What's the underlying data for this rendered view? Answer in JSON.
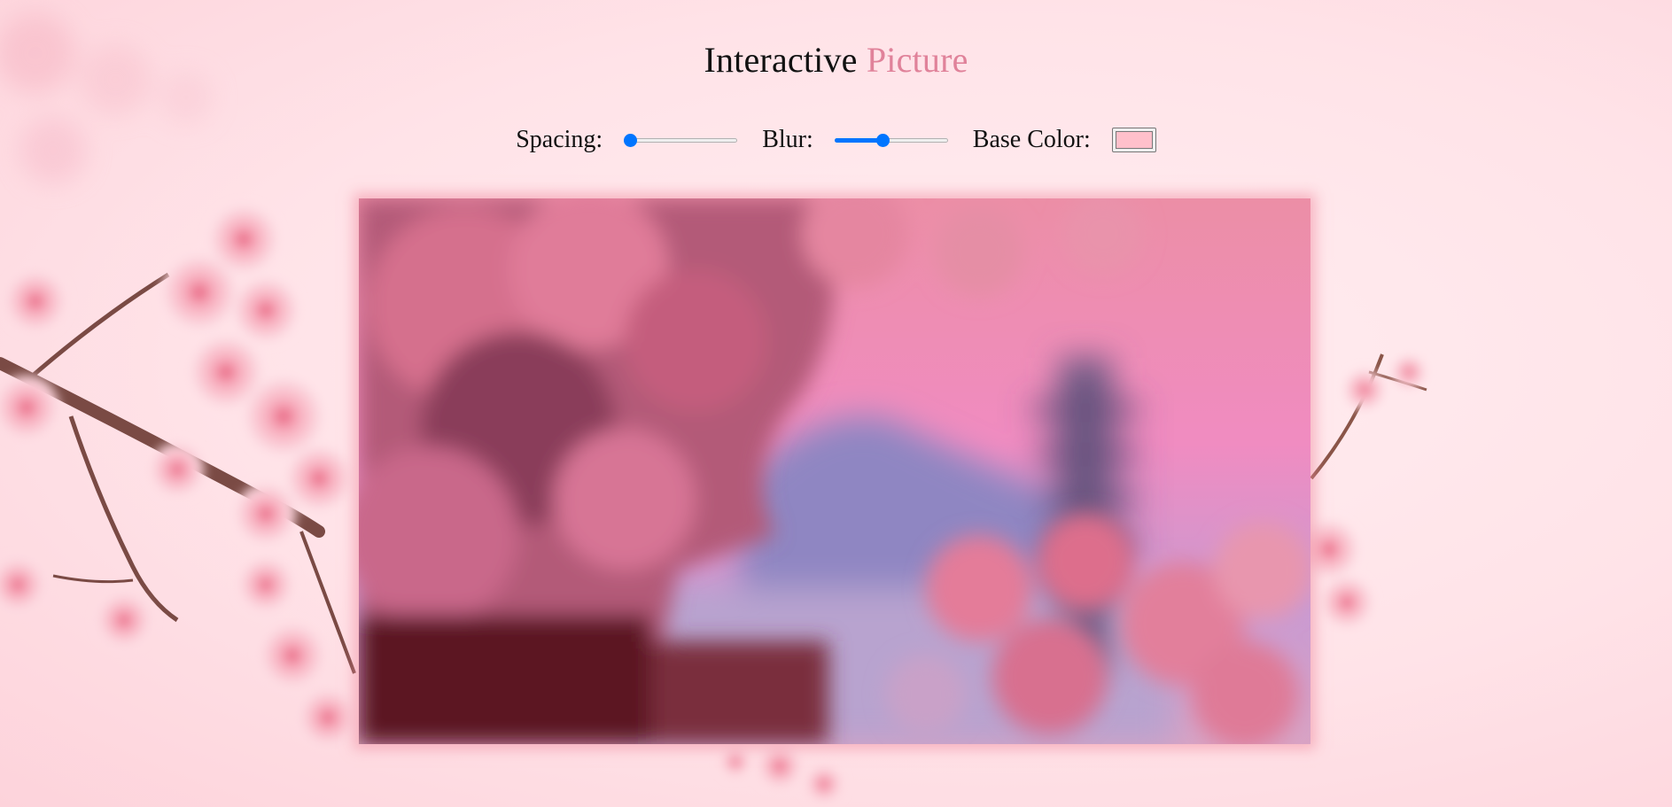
{
  "title": {
    "main": "Interactive",
    "accent": "Picture"
  },
  "controls": {
    "spacing": {
      "label": "Spacing:",
      "value_fraction": 0.0
    },
    "blur": {
      "label": "Blur:",
      "value_fraction": 0.42
    },
    "base_color": {
      "label": "Base Color:",
      "value": "#ffc0cb"
    }
  },
  "colors": {
    "page_background": "#ffe1e6",
    "title_accent": "#e0829a",
    "slider_accent": "#0075ff"
  },
  "picture": {
    "icon": "blurred-cherry-blossom-pagoda-photo"
  }
}
